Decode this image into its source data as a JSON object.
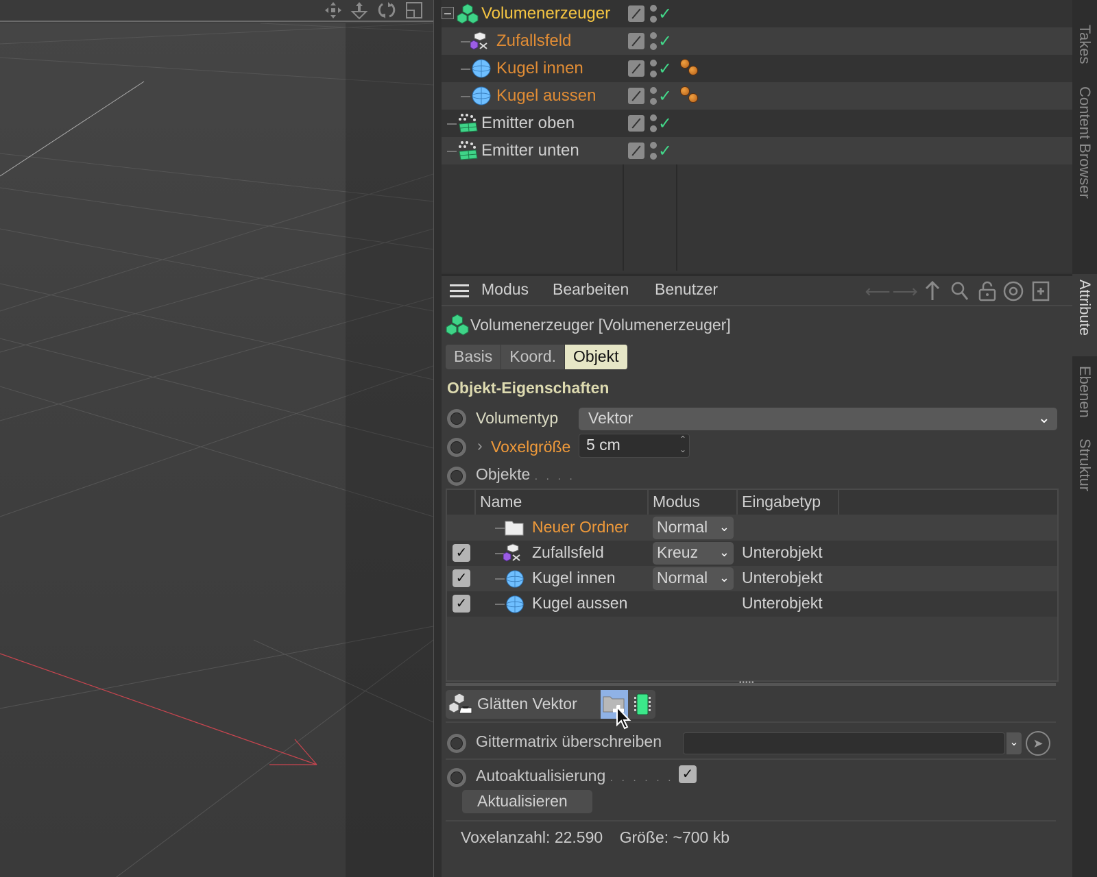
{
  "viewport": {
    "toolbar_icons": [
      "move-icon",
      "camera-dolly-icon",
      "rotate-icon",
      "maximize-view-icon"
    ]
  },
  "object_manager": {
    "rows": [
      {
        "name": "Volumenerzeuger",
        "color": "#f5c542",
        "icon": "volume-builder-icon",
        "level": 0,
        "expanded": true,
        "tag": null
      },
      {
        "name": "Zufallsfeld",
        "color": "#e08c35",
        "icon": "random-field-icon",
        "level": 1,
        "tag": null
      },
      {
        "name": "Kugel innen",
        "color": "#e08c35",
        "icon": "sphere-icon",
        "level": 1,
        "tag": "material-tag"
      },
      {
        "name": "Kugel aussen",
        "color": "#e08c35",
        "icon": "sphere-icon",
        "level": 1,
        "tag": "material-tag"
      },
      {
        "name": "Emitter oben",
        "color": "#cfcfcf",
        "icon": "emitter-icon",
        "level": 0,
        "tag": null
      },
      {
        "name": "Emitter unten",
        "color": "#cfcfcf",
        "icon": "emitter-icon",
        "level": 0,
        "tag": null
      }
    ]
  },
  "side_tabs": {
    "top": [
      "Takes",
      "Content Browser"
    ],
    "bottom": [
      "Attribute",
      "Ebenen",
      "Struktur"
    ],
    "active": "Attribute"
  },
  "attributes": {
    "menu": {
      "items": [
        "Modus",
        "Bearbeiten",
        "Benutzer"
      ]
    },
    "nav_icons": [
      "back-arrow-icon",
      "forward-arrow-icon",
      "up-arrow-icon",
      "search-icon",
      "lock-icon",
      "target-icon",
      "new-panel-icon"
    ],
    "object_title": "Volumenerzeuger [Volumenerzeuger]",
    "tabs": [
      {
        "label": "Basis",
        "active": false
      },
      {
        "label": "Koord.",
        "active": false
      },
      {
        "label": "Objekt",
        "active": true
      }
    ],
    "section_title": "Objekt-Eigenschaften",
    "volumentyp": {
      "label": "Volumentyp",
      "value": "Vektor"
    },
    "voxelgroesse": {
      "label": "Voxelgröße",
      "value": "5 cm"
    },
    "objekte": {
      "label": "Objekte",
      "dots": ". . . ."
    },
    "objects_list": {
      "headers": [
        "Name",
        "Modus",
        "Eingabetyp"
      ],
      "rows": [
        {
          "checked": null,
          "name": "Neuer Ordner",
          "icon": "folder-icon",
          "mode": "Normal",
          "input_type": "",
          "highlight": true
        },
        {
          "checked": true,
          "name": "Zufallsfeld",
          "icon": "random-field-icon",
          "mode": "Kreuz",
          "input_type": "Unterobjekt",
          "highlight": false
        },
        {
          "checked": true,
          "name": "Kugel innen",
          "icon": "sphere-icon",
          "mode": "Normal",
          "input_type": "Unterobjekt",
          "highlight": false
        },
        {
          "checked": true,
          "name": "Kugel aussen",
          "icon": "sphere-icon",
          "mode": "",
          "input_type": "Unterobjekt",
          "highlight": false
        }
      ]
    },
    "smooth_layer": {
      "label": "Glätten Vektor"
    },
    "gittermatrix": {
      "label": "Gittermatrix überschreiben",
      "value": ""
    },
    "autoupdate": {
      "label": "Autoaktualisierung",
      "dots": ". . . . . .",
      "checked": true
    },
    "update_button": "Aktualisieren",
    "stats": {
      "voxel_count": "Voxelanzahl: 22.590",
      "size": "Größe: ~700 kb"
    }
  }
}
